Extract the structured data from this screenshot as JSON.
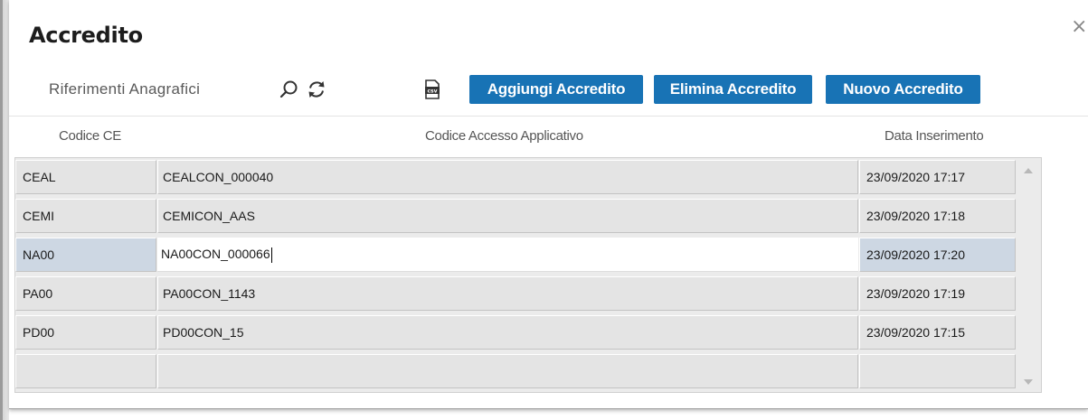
{
  "dialog": {
    "title": "Accredito",
    "close_icon": "close-icon",
    "close_glyph": "×"
  },
  "toolbar": {
    "search_placeholder": "Riferimenti Anagrafici",
    "search_icon": "search-icon",
    "refresh_icon": "refresh-icon",
    "csv_icon": "csv-export-icon",
    "csv_label": "csv",
    "add_label": "Aggiungi Accredito",
    "delete_label": "Elimina Accredito",
    "new_label": "Nuovo Accredito"
  },
  "columns": {
    "codice_ce": "Codice CE",
    "codice_accesso": "Codice Accesso Applicativo",
    "data_inserimento": "Data Inserimento"
  },
  "rows": [
    {
      "codice_ce": "CEAL",
      "codice_accesso": "CEALCON_000040",
      "data": "23/09/2020 17:17"
    },
    {
      "codice_ce": "CEMI",
      "codice_accesso": "CEMICON_AAS",
      "data": "23/09/2020 17:18"
    },
    {
      "codice_ce": "NA00",
      "codice_accesso": "NA00CON_000066",
      "data": "23/09/2020 17:20"
    },
    {
      "codice_ce": "PA00",
      "codice_accesso": "PA00CON_1143",
      "data": "23/09/2020 17:19"
    },
    {
      "codice_ce": "PD00",
      "codice_accesso": "PD00CON_15",
      "data": "23/09/2020 17:15"
    },
    {
      "codice_ce": "",
      "codice_accesso": "",
      "data": ""
    }
  ],
  "selected_row_index": 2,
  "colors": {
    "button_bg": "#1873b5",
    "button_text": "#ffffff",
    "selected_row_bg": "#cdd7e3",
    "row_bg": "#e4e4e4"
  }
}
